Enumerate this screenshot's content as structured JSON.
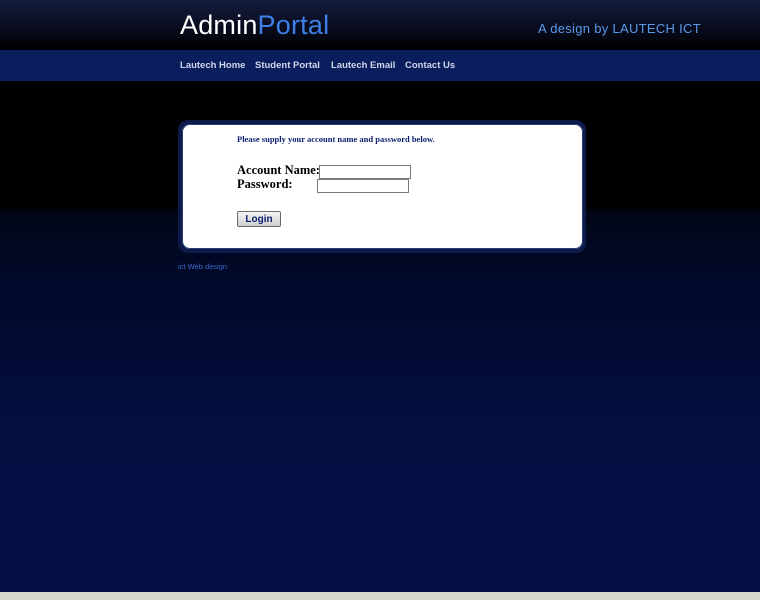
{
  "header": {
    "brand_part1": "Admin",
    "brand_part2": "Portal",
    "tagline": "A design by LAUTECH ICT"
  },
  "nav": {
    "items": [
      {
        "label": "Lautech Home"
      },
      {
        "label": "Student Portal"
      },
      {
        "label": "Lautech Email"
      },
      {
        "label": "Contact Us"
      }
    ]
  },
  "login": {
    "instruction": "Please supply your account name and password below.",
    "account_label": "Account Name:",
    "account_value": "",
    "password_label": "Password:",
    "password_value": "",
    "button_label": "Login"
  },
  "footer": {
    "link_text": "ict Web design"
  },
  "colors": {
    "brand_white": "#ffffff",
    "brand_blue": "#3d7fe6",
    "nav_bg": "#0a1d5c",
    "panel_text": "#0b1d6e"
  }
}
